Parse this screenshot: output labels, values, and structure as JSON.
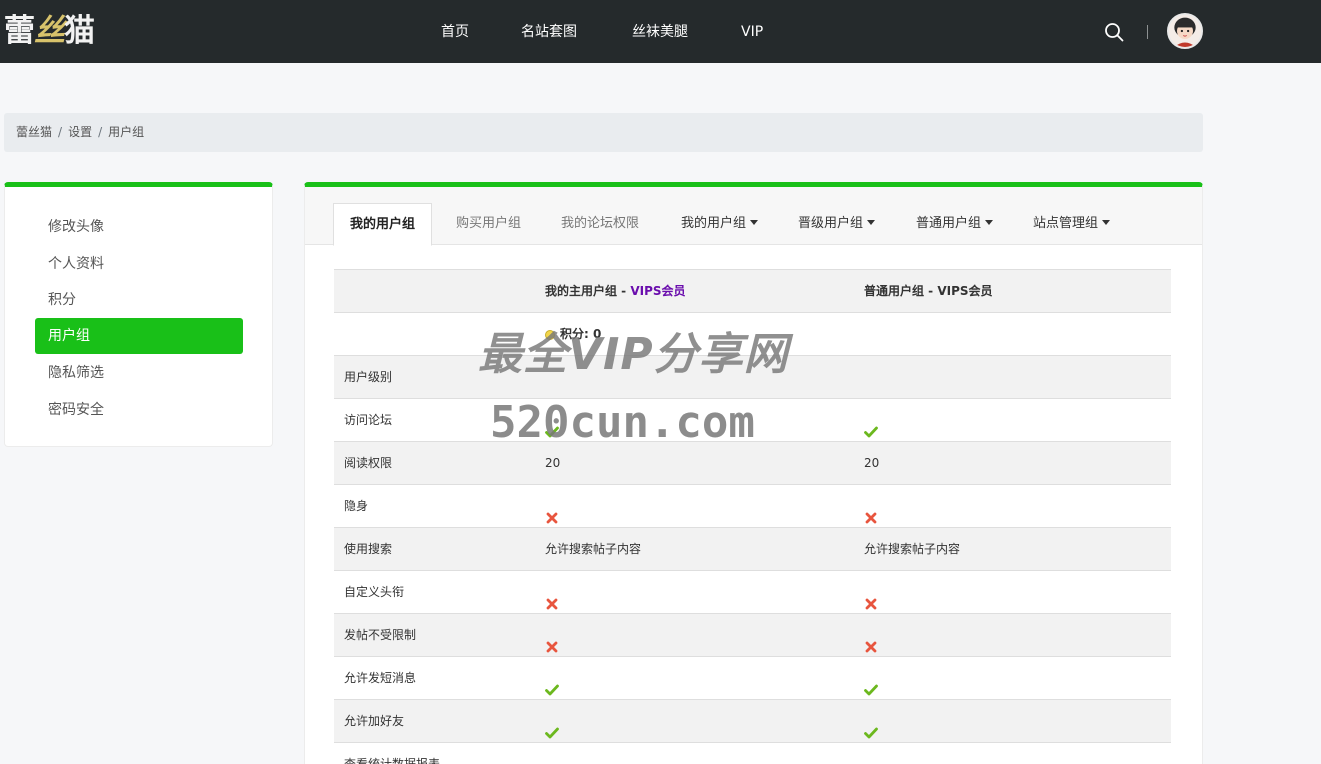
{
  "header": {
    "logo": {
      "part1": "蕾",
      "part2": "丝",
      "part3": "猫"
    },
    "nav": [
      "首页",
      "名站套图",
      "丝袜美腿",
      "VIP"
    ]
  },
  "breadcrumb": [
    "蕾丝猫",
    "设置",
    "用户组"
  ],
  "sidebar": {
    "items": [
      "修改头像",
      "个人资料",
      "积分",
      "用户组",
      "隐私筛选",
      "密码安全"
    ],
    "active_index": 3
  },
  "tabs": [
    "我的用户组",
    "购买用户组",
    "我的论坛权限",
    "我的用户组",
    "晋级用户组",
    "普通用户组",
    "站点管理组"
  ],
  "table": {
    "header": {
      "col1_prefix": "我的主用户组 - ",
      "col1_group": "VIPS会员",
      "col2": "普通用户组 - VIPS会员"
    },
    "points": "积分: 0",
    "rows": [
      {
        "label": "用户级别",
        "col1": "",
        "col2": ""
      },
      {
        "label": "访问论坛",
        "col1": "✔",
        "col2": "✔"
      },
      {
        "label": "阅读权限",
        "col1": "20",
        "col2": "20"
      },
      {
        "label": "隐身",
        "col1": "✖",
        "col2": "✖"
      },
      {
        "label": "使用搜索",
        "col1": "允许搜索帖子内容",
        "col2": "允许搜索帖子内容"
      },
      {
        "label": "自定义头衔",
        "col1": "✖",
        "col2": "✖"
      },
      {
        "label": "发帖不受限制",
        "col1": "✖",
        "col2": "✖"
      },
      {
        "label": "允许发短消息",
        "col1": "✔",
        "col2": "✔"
      },
      {
        "label": "允许加好友",
        "col1": "✔",
        "col2": "✔"
      },
      {
        "label": "查看统计数据报表",
        "col1": "✖",
        "col2": "✖"
      }
    ]
  },
  "watermark": {
    "line1": "最全VIP分享网",
    "line2": "520cun.com"
  },
  "colors": {
    "accent": "#19c018",
    "header_bg": "#252a2c",
    "check": "#6cb81e",
    "cross": "#e8553e",
    "vip": "#6a0dad"
  }
}
